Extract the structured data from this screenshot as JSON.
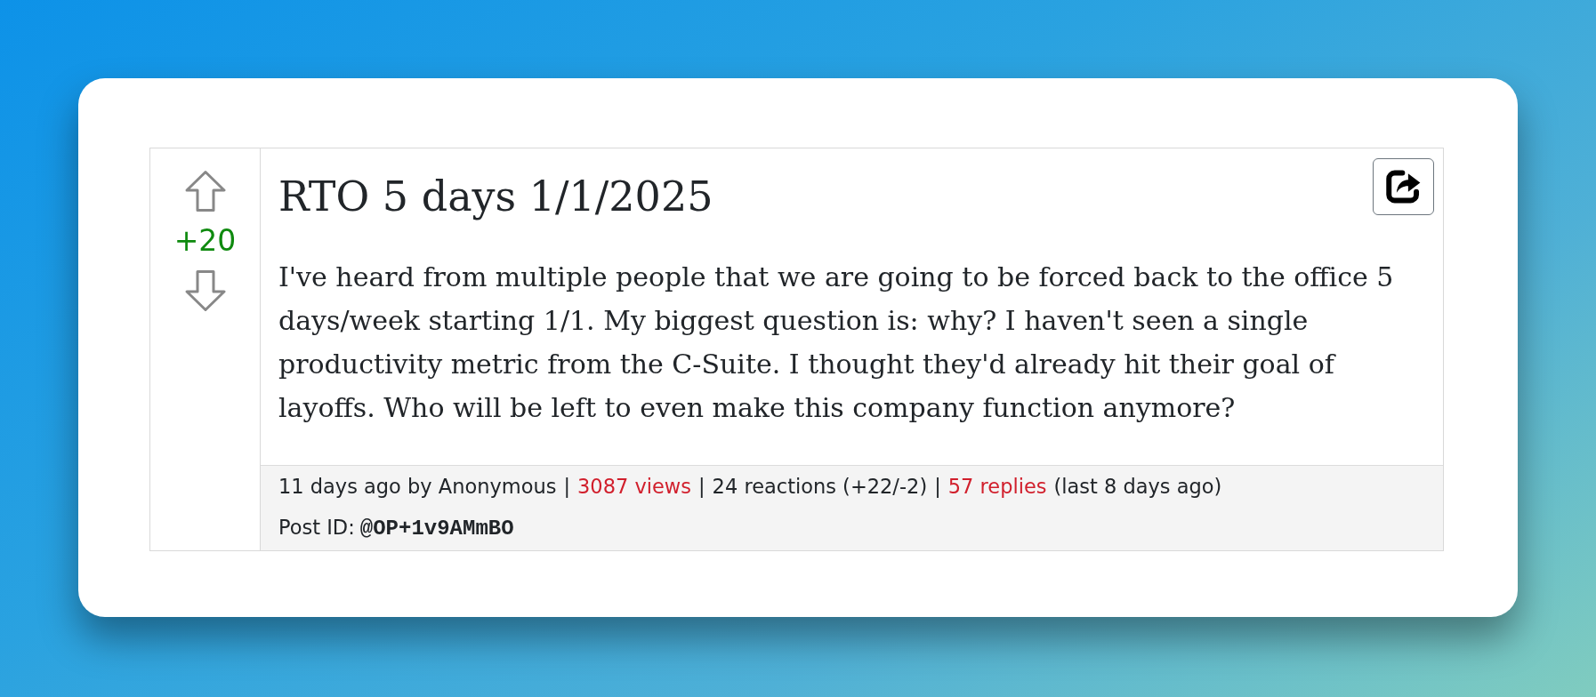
{
  "post": {
    "vote": {
      "score": "+20"
    },
    "title": "RTO 5 days 1/1/2025",
    "body": "I've heard from multiple people that we are going to be forced back to the office 5 days/week starting 1/1. My biggest question is: why? I haven't seen a single productivity metric from the C-Suite. I thought they'd already hit their goal of layoffs. Who will be left to even make this company function anymore?",
    "meta": {
      "posted": "11 days ago by Anonymous",
      "views": "3087 views",
      "reactions": "24 reactions (+22/-2)",
      "replies": "57 replies",
      "last_reply": "(last 8 days ago)",
      "separators": [
        "|",
        "|",
        "|"
      ]
    },
    "post_id": {
      "label": "Post ID:",
      "value": "@OP+1v9AMmBO"
    }
  }
}
